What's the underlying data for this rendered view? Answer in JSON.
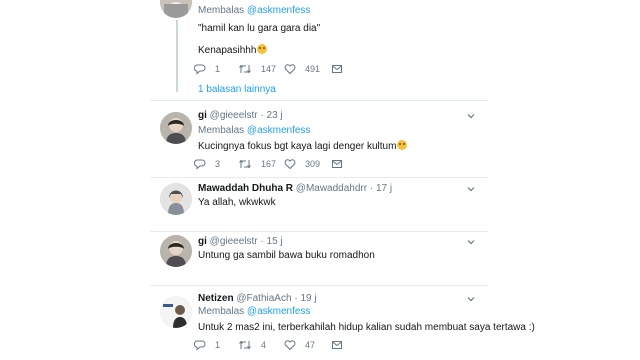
{
  "tweets": [
    {
      "reply_prefix": "Membalas",
      "reply_to": "@askmenfess",
      "text_line1": "\"hamil kan lu gara gara dia\"",
      "text_line2": "Kenapasihhh",
      "emoji": "crying-face",
      "counts": {
        "reply": "1",
        "retweet": "147",
        "like": "491"
      },
      "more_replies": "1 balasan lainnya"
    },
    {
      "name": "gi",
      "handle": "@gieeelstr",
      "time": "23 j",
      "reply_prefix": "Membalas",
      "reply_to": "@askmenfess",
      "text": "Kucingnya fokus bgt kaya lagi denger kultum",
      "emoji": "tears-of-joy-face",
      "counts": {
        "reply": "3",
        "retweet": "167",
        "like": "309"
      }
    },
    {
      "name": "Mawaddah Dhuha R",
      "handle": "@Mawaddahdrr",
      "time": "17 j",
      "text": "Ya allah,  wkwkwk"
    },
    {
      "name": "gi",
      "handle": "@gieeelstr",
      "time": "15 j",
      "text": "Untung ga sambil bawa buku romadhon"
    },
    {
      "name": "Netizen",
      "handle": "@FathiaAch",
      "time": "19 j",
      "reply_prefix": "Membalas",
      "reply_to": "@askmenfess",
      "text": "Untuk 2 mas2 ini, terberkahilah hidup kalian sudah membuat saya tertawa :)",
      "counts": {
        "reply": "1",
        "retweet": "4",
        "like": "47"
      }
    }
  ],
  "colors": {
    "accent": "#1da1f2",
    "muted": "#657786",
    "separator": "#e6ecf0",
    "text": "#14171a"
  }
}
